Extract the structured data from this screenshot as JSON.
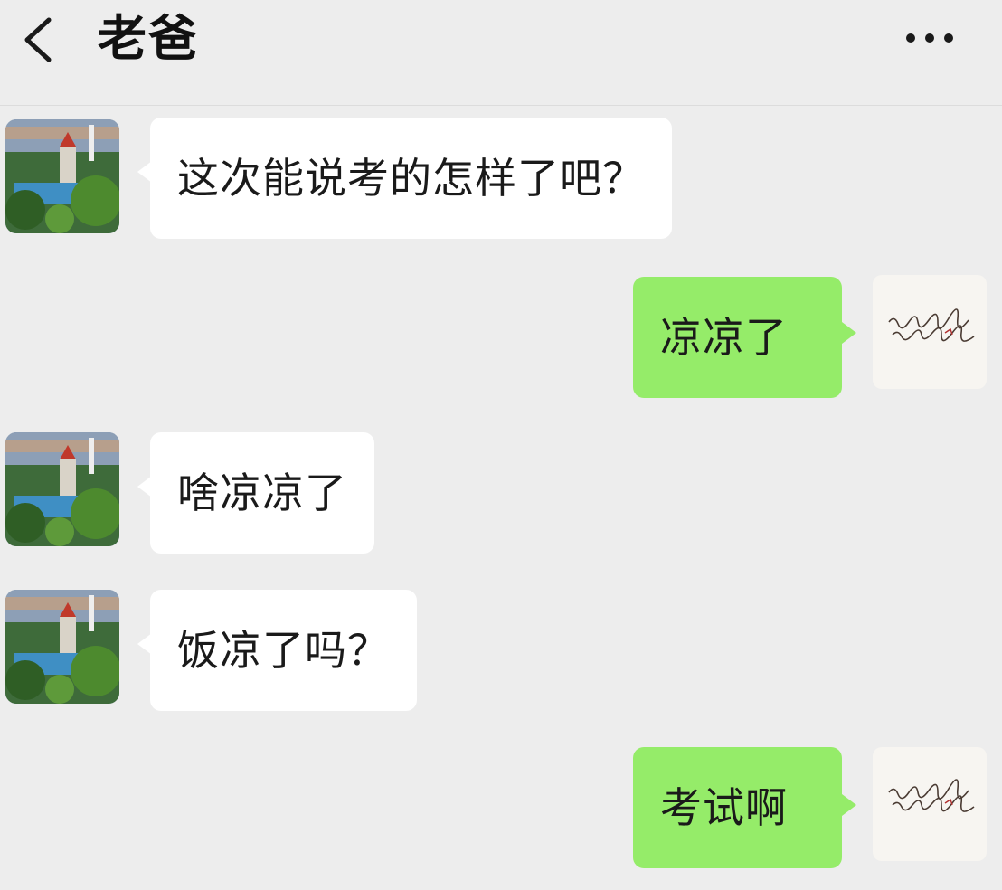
{
  "header": {
    "title": "老爸",
    "back_icon": "chevron-left-icon",
    "more_icon": "more-horizontal-icon"
  },
  "colors": {
    "background": "#ededed",
    "incoming_bubble": "#ffffff",
    "outgoing_bubble": "#95ec69"
  },
  "messages": [
    {
      "sender": "dad",
      "text": "这次能说考的怎样了吧？"
    },
    {
      "sender": "me",
      "text": "凉凉了"
    },
    {
      "sender": "dad",
      "text": "啥凉凉了"
    },
    {
      "sender": "dad",
      "text": "饭凉了吗？"
    },
    {
      "sender": "me",
      "text": "考试啊"
    }
  ]
}
